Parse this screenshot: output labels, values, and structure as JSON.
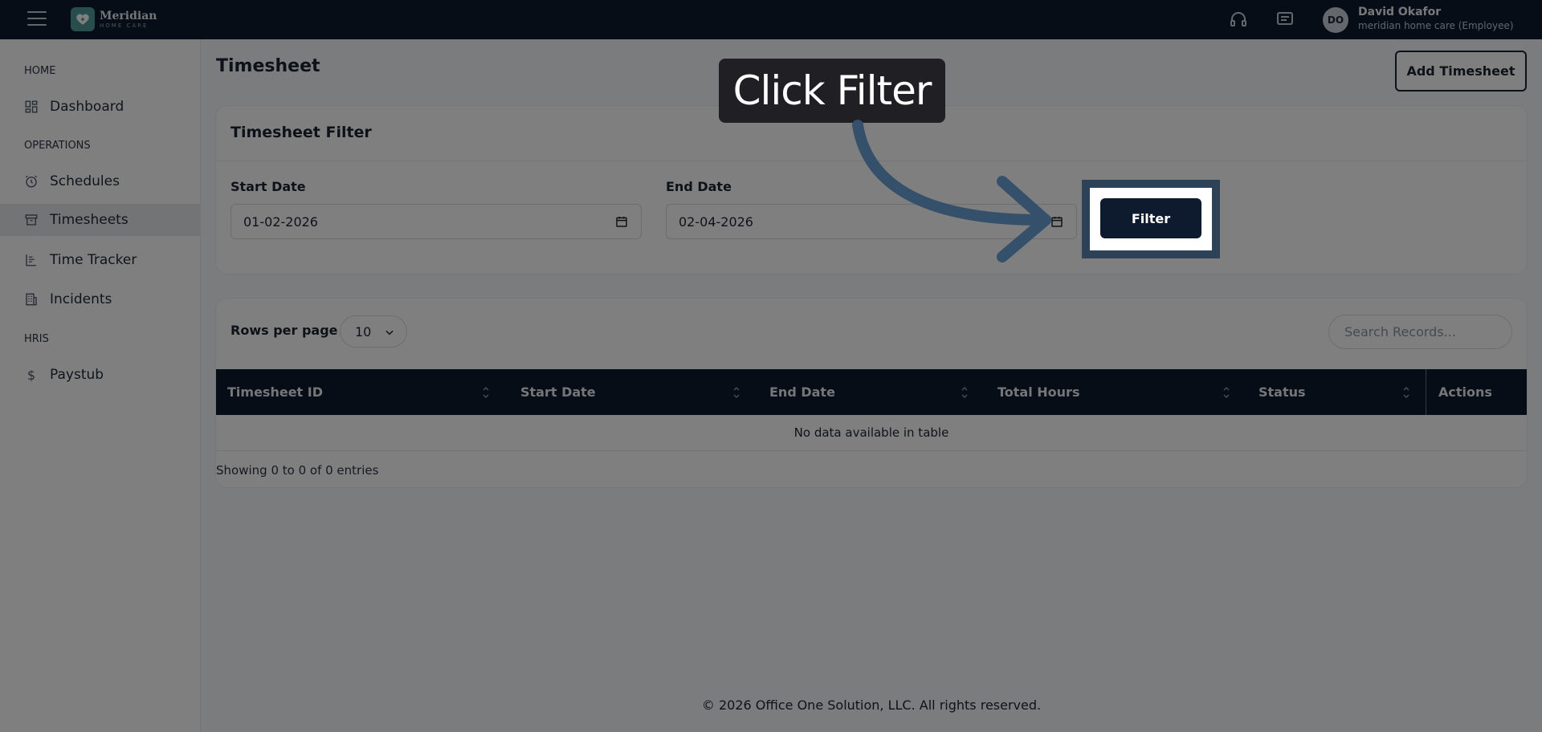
{
  "brand": {
    "name": "Meridian",
    "sub": "HOME CARE"
  },
  "user": {
    "initials": "DO",
    "name": "David Okafor",
    "role": "meridian home care (Employee)"
  },
  "sidebar": {
    "sections": [
      {
        "label": "HOME",
        "items": [
          {
            "label": "Dashboard",
            "icon": "dashboard-icon"
          }
        ]
      },
      {
        "label": "OPERATIONS",
        "items": [
          {
            "label": "Schedules",
            "icon": "alarm-clock-icon"
          },
          {
            "label": "Timesheets",
            "icon": "archive-box-icon",
            "active": true
          },
          {
            "label": "Time Tracker",
            "icon": "list-tree-icon"
          },
          {
            "label": "Incidents",
            "icon": "building-icon"
          }
        ]
      },
      {
        "label": "HRIS",
        "items": [
          {
            "label": "Paystub",
            "icon": "dollar-icon"
          }
        ]
      }
    ]
  },
  "page": {
    "title": "Timesheet",
    "add_button": "Add Timesheet"
  },
  "filter": {
    "title": "Timesheet Filter",
    "start_label": "Start Date",
    "start_value": "01-02-2026",
    "end_label": "End Date",
    "end_value": "02-04-2026",
    "button": "Filter"
  },
  "table": {
    "rows_label": "Rows per page",
    "rows_value": "10",
    "search_placeholder": "Search Records...",
    "columns": [
      "Timesheet ID",
      "Start Date",
      "End Date",
      "Total Hours",
      "Status",
      "Actions"
    ],
    "empty_text": "No data available in table",
    "showing": "Showing 0 to 0 of 0 entries"
  },
  "footer": "© 2026 Office One Solution, LLC. All rights reserved.",
  "callout": "Click Filter",
  "colors": {
    "navy": "#0e1a2e",
    "highlight": "#2d4157",
    "arrow": "#34506b"
  }
}
